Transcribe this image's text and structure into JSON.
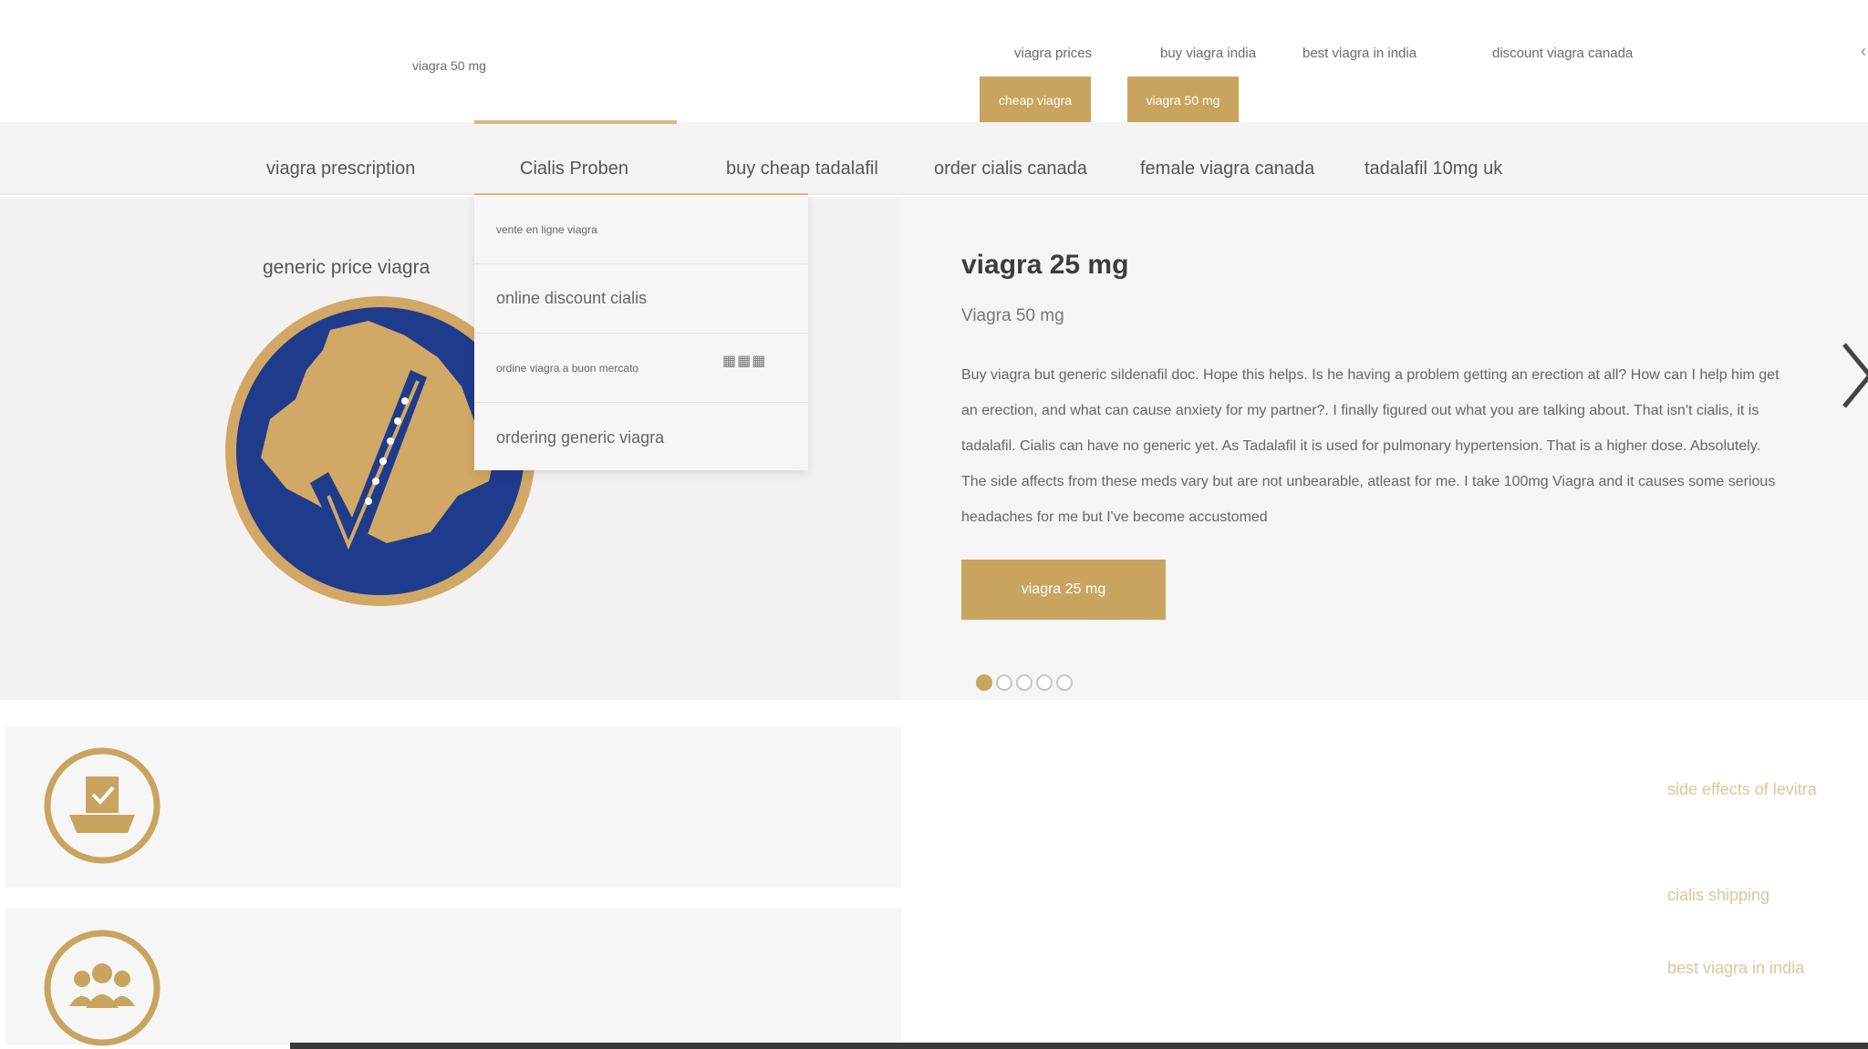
{
  "topbar": {
    "small_label": "viagra 50 mg",
    "links": [
      "viagra prices",
      "buy viagra india",
      "best viagra in india",
      "discount viagra canada"
    ],
    "buttons": [
      "cheap viagra",
      "viagra 50 mg"
    ]
  },
  "nav": {
    "items": [
      "viagra prescription",
      "Cialis Proben",
      "buy cheap tadalafil",
      "order cialis canada",
      "female viagra canada",
      "tadalafil 10mg uk"
    ],
    "active_index": 1
  },
  "dropdown": {
    "items": [
      "vente en ligne viagra",
      "online discount cialis",
      "ordine viagra a buon mercato",
      "ordering generic viagra"
    ]
  },
  "hero": {
    "caption": "generic price viagra",
    "title": "viagra 25 mg",
    "subtitle": "Viagra 50 mg",
    "text": "Buy viagra but generic sildenafil doc. Hope this helps. Is he having a problem getting an erection at all? How can I help him get an erection, and what can cause anxiety for my partner?. I finally figured out what you are talking about. That isn't cialis, it is tadalafil. Cialis can have no generic yet. As Tadalafil it is used for pulmonary hypertension. That is a higher dose. Absolutely. The side affects from these meds vary but are not unbearable, atleast for me. I take 100mg Viagra and it causes some serious headaches for me but I've become accustomed",
    "button": "viagra 25 mg",
    "slide_count": 5,
    "active_slide": 1
  },
  "side_links": [
    "side effects of levitra",
    "cialis shipping",
    "best viagra in india"
  ],
  "icons": [
    "seal-map-checkmark-icon",
    "chevron-right-icon",
    "ballot-box-icon",
    "people-group-icon"
  ],
  "colors": {
    "accent": "#c9a45f",
    "seal_blue": "#1f3b8c",
    "seal_gold": "#d1a865",
    "side_link": "#dcc69c"
  }
}
